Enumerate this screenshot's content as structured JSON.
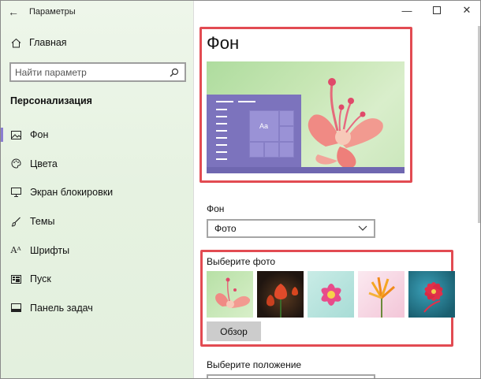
{
  "window": {
    "title": "Параметры"
  },
  "sidebar": {
    "home_label": "Главная",
    "search_placeholder": "Найти параметр",
    "section_title": "Персонализация",
    "items": [
      {
        "label": "Фон",
        "icon": "picture-icon",
        "active": true
      },
      {
        "label": "Цвета",
        "icon": "palette-icon",
        "active": false
      },
      {
        "label": "Экран блокировки",
        "icon": "monitor-icon",
        "active": false
      },
      {
        "label": "Темы",
        "icon": "brush-icon",
        "active": false
      },
      {
        "label": "Шрифты",
        "icon": "font-icon",
        "active": false
      },
      {
        "label": "Пуск",
        "icon": "start-icon",
        "active": false
      },
      {
        "label": "Панель задач",
        "icon": "taskbar-icon",
        "active": false
      }
    ]
  },
  "main": {
    "page_title": "Фон",
    "preview": {
      "tile_text": "Aa"
    },
    "background_label": "Фон",
    "background_value": "Фото",
    "choose_photo_label": "Выберите фото",
    "browse_label": "Обзор",
    "position_label": "Выберите положение"
  },
  "colors": {
    "accent": "#8a7dd1",
    "highlight_border": "#e24b52",
    "sidebar_bg": "#e6f2e1"
  }
}
